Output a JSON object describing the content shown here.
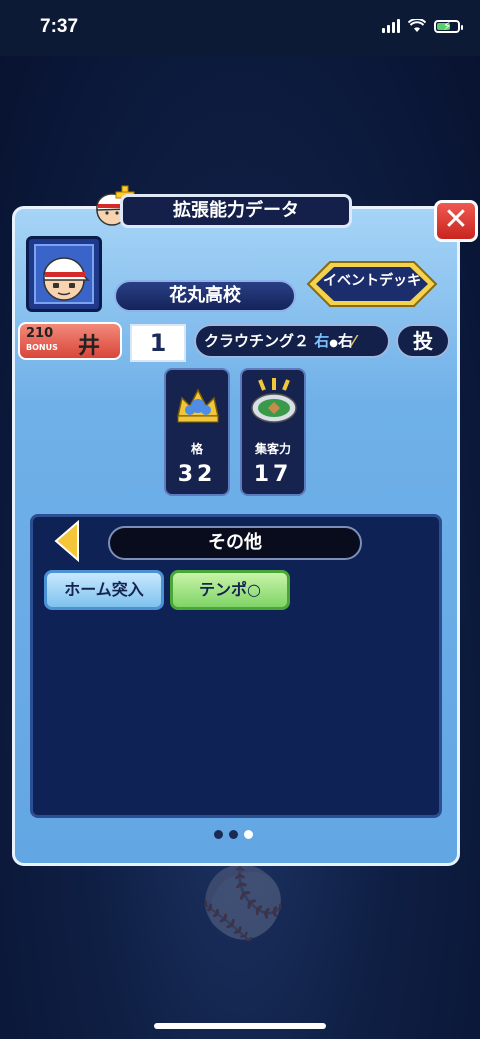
{
  "status_bar": {
    "time": "7:37"
  },
  "title": "拡張能力データ",
  "school": "花丸高校",
  "event_deck_label": "イベントデッキ",
  "player": {
    "bonus_value": "210",
    "bonus_label": "BONUS",
    "name_fragment": "井",
    "number": "1",
    "batting_form": "クラウチング２",
    "throw_hand": "右",
    "bat_hand": "右",
    "position": "投"
  },
  "stats": [
    {
      "label": "格",
      "value": "32",
      "icon": "trophy-icon"
    },
    {
      "label": "集客力",
      "value": "17",
      "icon": "stadium-icon"
    }
  ],
  "category": "その他",
  "skills": [
    {
      "label": "ホーム突入",
      "color": "#7ec2ee"
    },
    {
      "label": "テンポ○",
      "color": "#7fd467"
    }
  ],
  "page_indicator": {
    "total": 3,
    "current": 3
  }
}
